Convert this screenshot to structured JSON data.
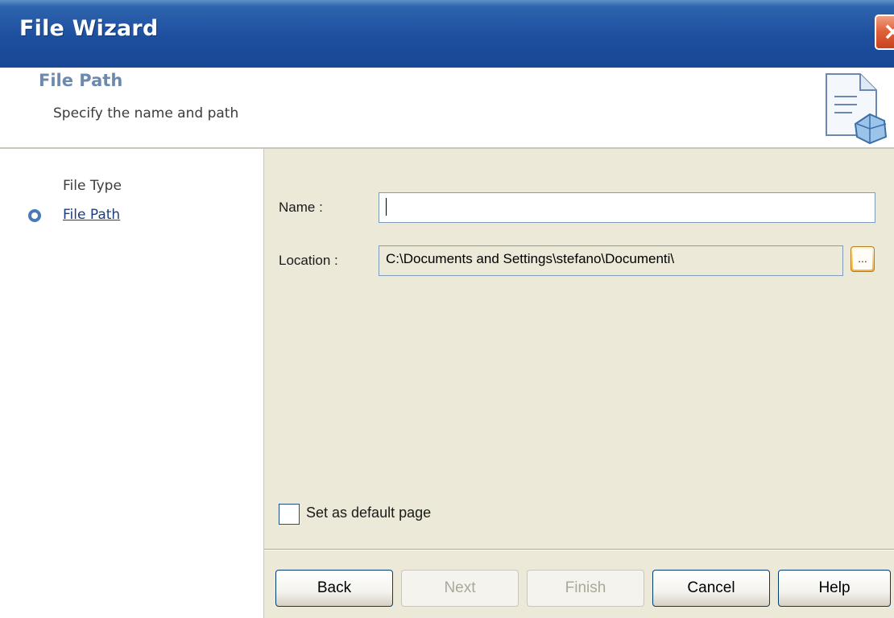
{
  "window": {
    "title": "File Wizard",
    "close_glyph": "×"
  },
  "header": {
    "title": "File Path",
    "subtitle": "Specify the name and path",
    "icon": "document-wizard-icon"
  },
  "steps": [
    {
      "label": "File Type",
      "active": false
    },
    {
      "label": "File Path",
      "active": true
    }
  ],
  "form": {
    "name_label": "Name :",
    "name_value": "",
    "location_label": "Location :",
    "location_value": "C:\\Documents and Settings\\stefano\\Documenti\\",
    "browse_label": "..."
  },
  "default_page": {
    "label": "Set as default page",
    "checked": false
  },
  "buttons": {
    "back": "Back",
    "next": "Next",
    "finish": "Finish",
    "cancel": "Cancel",
    "help": "Help"
  },
  "colors": {
    "titlebar": "#1d4f9f",
    "header_title": "#6d89ae",
    "panel_bg": "#ece9d8"
  }
}
